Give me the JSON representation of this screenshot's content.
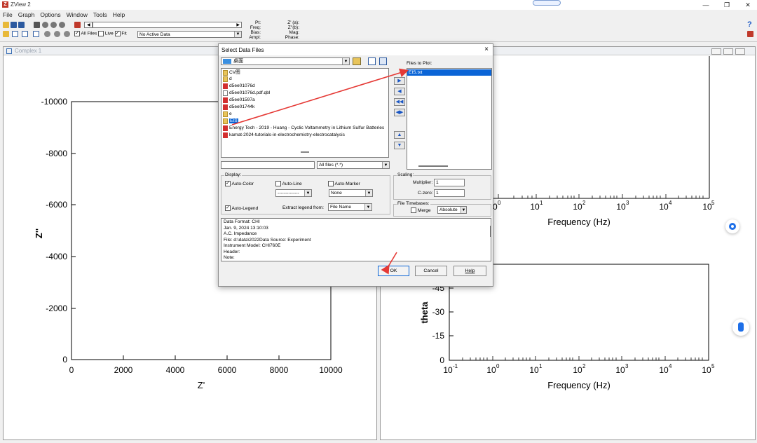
{
  "app": {
    "title": "ZView 2",
    "icon_letter": "Z"
  },
  "menu": [
    "File",
    "Graph",
    "Options",
    "Window",
    "Tools",
    "Help"
  ],
  "toolbar": {
    "all_files_label": "All Files",
    "live_label": "Live",
    "fit_label": "Fit",
    "active_data_value": "No Active Data",
    "readouts_left": [
      "Pt:",
      "Freq:",
      "Bias:",
      "Ampl:"
    ],
    "readouts_right": [
      "Z' (a):",
      "Z''(b):",
      "Mag:",
      "Phase:"
    ],
    "help_icon_label": "?"
  },
  "windows": {
    "left_title": "Complex 1"
  },
  "plots": {
    "complex": {
      "ylabel": "Z''",
      "xlabel": "Z'",
      "yticks": [
        "-10000",
        "-8000",
        "-6000",
        "-4000",
        "-2000",
        "0"
      ],
      "xticks": [
        "0",
        "2000",
        "4000",
        "6000",
        "8000",
        "10000"
      ]
    },
    "bode_top": {
      "xlabel": "Frequency (Hz)",
      "xticks": [
        "10",
        "10",
        "10",
        "10",
        "10",
        "10"
      ],
      "xexp": [
        "0",
        "1",
        "2",
        "3",
        "4",
        "5"
      ]
    },
    "bode_bottom": {
      "ylabel": "theta",
      "yticks": [
        "-45",
        "-30",
        "-15",
        "0"
      ],
      "xlabel": "Frequency (Hz)",
      "xticks": [
        "10",
        "10",
        "10",
        "10",
        "10",
        "10",
        "10"
      ],
      "xexp": [
        "-1",
        "0",
        "1",
        "2",
        "3",
        "4",
        "5"
      ]
    }
  },
  "dialog": {
    "title": "Select Data Files",
    "close_label": "×",
    "folder_value": "桌面",
    "files": [
      {
        "name": "CV图",
        "type": "folder"
      },
      {
        "name": "d",
        "type": "folder"
      },
      {
        "name": "d5ee01076d",
        "type": "doc"
      },
      {
        "name": "d5ee01076d.pdf.qbl",
        "type": "file"
      },
      {
        "name": "d5ee01597a",
        "type": "doc"
      },
      {
        "name": "d5ee01744k",
        "type": "doc"
      },
      {
        "name": "e",
        "type": "folder"
      },
      {
        "name": "EIS",
        "type": "folder",
        "selected": true
      },
      {
        "name": "Energy Tech - 2019 - Huang - Cyclic Voltammetry in Lithium Sulfur Batteries",
        "type": "doc"
      },
      {
        "name": "kamat-2024-tutorials-in-electrochemistry-electrocatalysis",
        "type": "doc"
      }
    ],
    "filter_value": "All files (*.*)",
    "files_to_plot_label": "Files to Plot:",
    "files_to_plot": [
      "EIS.txt"
    ],
    "display_label": "Display:",
    "auto_color_label": "Auto-Color",
    "auto_line_label": "Auto-Line",
    "auto_marker_label": "Auto-Marker",
    "line_style_value": "--------------",
    "marker_value": "None",
    "auto_legend_label": "Auto-Legend",
    "extract_legend_label": "Extract legend from:",
    "extract_legend_value": "File Name",
    "scaling_label": "Scaling:",
    "multiplier_label": "Multiplier:",
    "multiplier_value": "1",
    "czero_label": "C-zero:",
    "czero_value": "1",
    "timebases_label": "File Timebases:",
    "merge_label": "Merge",
    "timebase_value": "Absolute",
    "info_lines": [
      "Data Format: CHI",
      "Jan. 9, 2024   13:10:03",
      "A.C. Impedance",
      "File: d:\\data\\2022Data Source:  Experiment",
      "Instrument Model:  CHI760E",
      "Header:",
      "Note:"
    ],
    "ok_label": "OK",
    "cancel_label": "Cancel",
    "help_label": "Help"
  },
  "colors": {
    "selection": "#0a64d6",
    "annotation_arrow": "#e53935",
    "accent_blue": "#1e6fe8"
  }
}
